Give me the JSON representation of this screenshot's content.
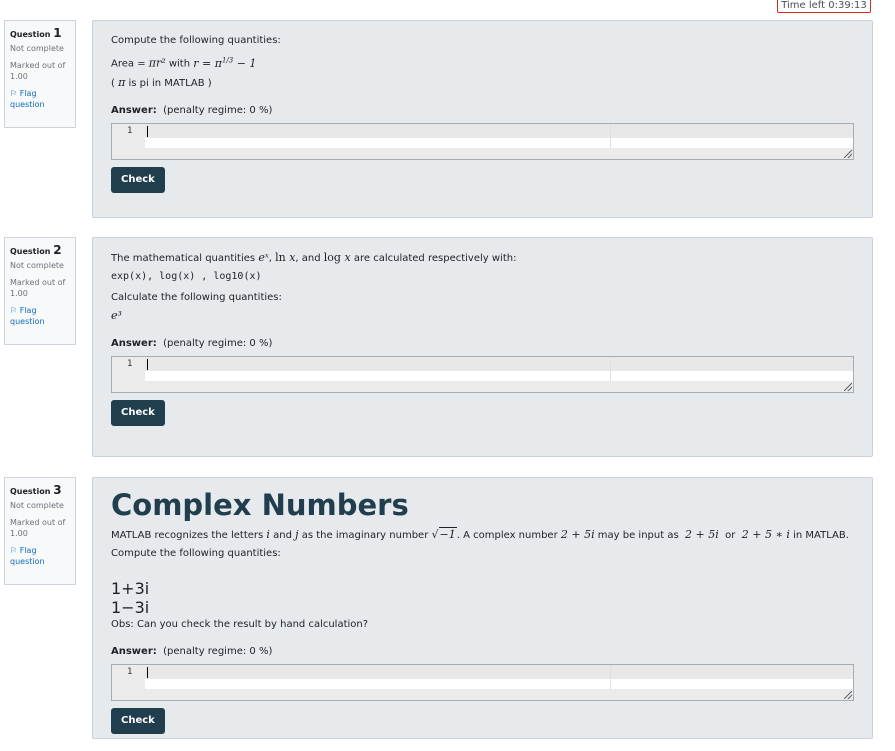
{
  "timer": {
    "text": "Time left 0:39:13"
  },
  "questions": [
    {
      "info": {
        "label": "Question",
        "number": "1",
        "state": "Not complete",
        "grade": "Marked out of 1.00",
        "flag": "Flag question"
      },
      "lines": {
        "intro": "Compute the following quantities:",
        "area_prefix": "Area = ",
        "area_with": " with ",
        "pi_note_pre": "( ",
        "pi_note_post": " is pi in MATLAB )"
      },
      "answer": {
        "label": "Answer:",
        "penalty": "(penalty regime: 0 %)",
        "line_number": "1"
      },
      "check": "Check"
    },
    {
      "info": {
        "label": "Question",
        "number": "2",
        "state": "Not complete",
        "grade": "Marked out of 1.00",
        "flag": "Flag question"
      },
      "lines": {
        "intro_pre": "The mathematical quantities ",
        "intro_mid1": ", ",
        "intro_mid2": ", and ",
        "intro_post": " are calculated respectively with:",
        "code": "exp(x), log(x) , log10(x)",
        "calc": "Calculate the following quantities:"
      },
      "answer": {
        "label": "Answer:",
        "penalty": "(penalty regime: 0 %)",
        "line_number": "1"
      },
      "check": "Check"
    },
    {
      "info": {
        "label": "Question",
        "number": "3",
        "state": "Not complete",
        "grade": "Marked out of 1.00",
        "flag": "Flag question"
      },
      "lines": {
        "title": "Complex Numbers",
        "p1_pre": "MATLAB recognizes the letters ",
        "p1_and": " and ",
        "p1_mid": " as the imaginary number ",
        "p1_mid2": ". A complex number ",
        "p1_mid3": " may be input as ",
        "p1_or": " or ",
        "p1_post": " in MATLAB.",
        "compute": "Compute the following quantities:",
        "obs": "Obs: Can you check the result by hand calculation?"
      },
      "answer": {
        "label": "Answer:",
        "penalty": "(penalty regime: 0 %)",
        "line_number": "1"
      },
      "check": "Check"
    }
  ]
}
